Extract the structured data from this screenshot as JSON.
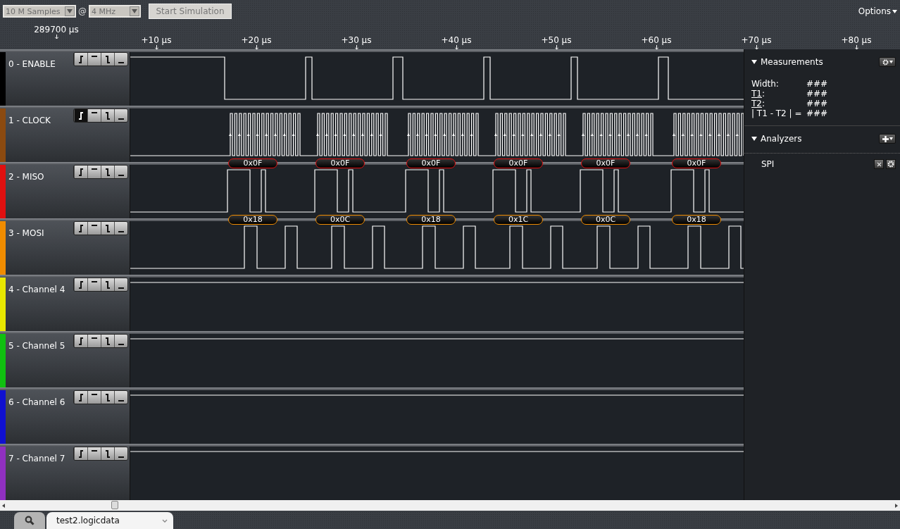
{
  "toolbar": {
    "samples": "10 M Samples",
    "at": "@",
    "rate": "4 MHz",
    "start_button": "Start Simulation",
    "options": "Options"
  },
  "ruler": {
    "cursor": "289700 µs",
    "ticks": [
      "+10 µs",
      "+20 µs",
      "+30 µs",
      "+40 µs",
      "+50 µs",
      "+60 µs",
      "+70 µs",
      "+80 µs"
    ]
  },
  "channels": [
    {
      "label": "0 - ENABLE",
      "color": "#000000",
      "kind": "strobe",
      "triggers": [
        {
          "kind": "rising",
          "selected": false
        },
        {
          "kind": "high",
          "selected": false
        },
        {
          "kind": "falling",
          "selected": false
        },
        {
          "kind": "low",
          "selected": false
        }
      ]
    },
    {
      "label": "1 - CLOCK",
      "color": "#8b4a10",
      "kind": "clock",
      "triggers": [
        {
          "kind": "rising",
          "selected": true
        },
        {
          "kind": "high",
          "selected": false
        },
        {
          "kind": "falling",
          "selected": false
        },
        {
          "kind": "low",
          "selected": false
        }
      ]
    },
    {
      "label": "2 - MISO",
      "color": "#e01010",
      "kind": "miso",
      "decoded": [
        "0x0F",
        "0x0F",
        "0x0F",
        "0x0F",
        "0x0F",
        "0x0F"
      ],
      "triggers": [
        {
          "kind": "rising",
          "selected": false
        },
        {
          "kind": "high",
          "selected": false
        },
        {
          "kind": "falling",
          "selected": false
        },
        {
          "kind": "low",
          "selected": false
        }
      ]
    },
    {
      "label": "3 - MOSI",
      "color": "#f08c00",
      "kind": "mosi",
      "decoded": [
        "0x18",
        "0x0C",
        "0x18",
        "0x1C",
        "0x0C",
        "0x18"
      ],
      "triggers": [
        {
          "kind": "rising",
          "selected": false
        },
        {
          "kind": "high",
          "selected": false
        },
        {
          "kind": "falling",
          "selected": false
        },
        {
          "kind": "low",
          "selected": false
        }
      ]
    },
    {
      "label": "4 - Channel 4",
      "color": "#e8e800",
      "kind": "flat",
      "triggers": [
        {
          "kind": "rising",
          "selected": false
        },
        {
          "kind": "high",
          "selected": false
        },
        {
          "kind": "falling",
          "selected": false
        },
        {
          "kind": "low",
          "selected": false
        }
      ]
    },
    {
      "label": "5 - Channel 5",
      "color": "#10c010",
      "kind": "flat",
      "triggers": [
        {
          "kind": "rising",
          "selected": false
        },
        {
          "kind": "high",
          "selected": false
        },
        {
          "kind": "falling",
          "selected": false
        },
        {
          "kind": "low",
          "selected": false
        }
      ]
    },
    {
      "label": "6 - Channel 6",
      "color": "#1010d0",
      "kind": "flat",
      "triggers": [
        {
          "kind": "rising",
          "selected": false
        },
        {
          "kind": "high",
          "selected": false
        },
        {
          "kind": "falling",
          "selected": false
        },
        {
          "kind": "low",
          "selected": false
        }
      ]
    },
    {
      "label": "7 - Channel 7",
      "color": "#9030c0",
      "kind": "flat",
      "triggers": [
        {
          "kind": "rising",
          "selected": false
        },
        {
          "kind": "high",
          "selected": false
        },
        {
          "kind": "falling",
          "selected": false
        },
        {
          "kind": "low",
          "selected": false
        }
      ]
    }
  ],
  "measurements": {
    "title": "Measurements",
    "expanded": true,
    "rows": [
      {
        "label": "Width:",
        "value": "###"
      },
      {
        "label": "T1",
        "suffix": ":",
        "link": true,
        "value": "###"
      },
      {
        "label": "T2",
        "suffix": ":",
        "link": true,
        "value": "###"
      },
      {
        "label": "| T1 - T2 | =",
        "value": "###"
      }
    ]
  },
  "analyzers": {
    "title": "Analyzers",
    "expanded": true,
    "items": [
      "SPI"
    ]
  },
  "tabs": [
    {
      "kind": "search",
      "selected": false
    },
    {
      "kind": "file",
      "label": "test2.logicdata",
      "selected": true
    }
  ]
}
